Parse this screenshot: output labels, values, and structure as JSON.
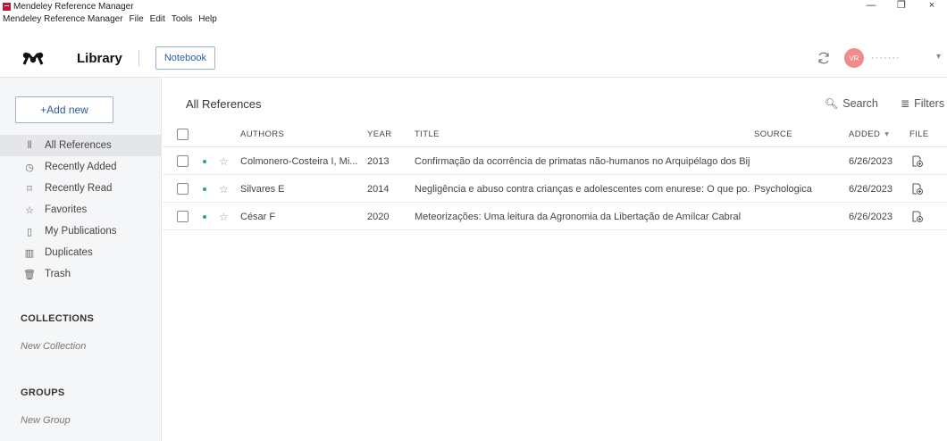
{
  "window": {
    "title": "Mendeley Reference Manager",
    "minimize": "—",
    "restore": "❐",
    "close": "×"
  },
  "menu": {
    "items": [
      "Mendeley Reference Manager",
      "File",
      "Edit",
      "Tools",
      "Help"
    ]
  },
  "header": {
    "library_label": "Library",
    "notebook_label": "Notebook",
    "avatar_initials": "VR",
    "user_name": "·······",
    "chevron": "▾"
  },
  "sidebar": {
    "add_new_label": "+Add new",
    "nav": [
      {
        "label": "All References",
        "icon": "library-icon",
        "glyph": "⫴"
      },
      {
        "label": "Recently Added",
        "icon": "clock-icon",
        "glyph": "◷"
      },
      {
        "label": "Recently Read",
        "icon": "bookmark-icon",
        "glyph": "⌑"
      },
      {
        "label": "Favorites",
        "icon": "star-icon",
        "glyph": "☆"
      },
      {
        "label": "My Publications",
        "icon": "publication-icon",
        "glyph": "▯"
      },
      {
        "label": "Duplicates",
        "icon": "duplicates-icon",
        "glyph": "▥"
      },
      {
        "label": "Trash",
        "icon": "trash-icon",
        "glyph": "🗑"
      }
    ],
    "collections_heading": "COLLECTIONS",
    "new_collection": "New Collection",
    "groups_heading": "GROUPS",
    "new_group": "New Group"
  },
  "main": {
    "title": "All References",
    "search_label": "Search",
    "filters_label": "Filters",
    "columns": {
      "authors": "AUTHORS",
      "year": "YEAR",
      "title": "TITLE",
      "source": "SOURCE",
      "added": "ADDED",
      "added_sort": "▾",
      "file": "FILE"
    },
    "rows": [
      {
        "authors": "Colmonero-Costeira I, Mi...",
        "year": "2013",
        "title": "Confirmação da ocorrência de primatas não-humanos no Arquipélago dos Bij...",
        "source": "",
        "added": "6/26/2023"
      },
      {
        "authors": "Silvares E",
        "year": "2014",
        "title": "Negligência e abuso contra crianças e adolescentes com enurese: O que po...",
        "source": "Psychologica",
        "added": "6/26/2023"
      },
      {
        "authors": "César F",
        "year": "2020",
        "title": "Meteorizações: Uma leitura da Agronomia da Libertação de Amílcar Cabral",
        "source": "",
        "added": "6/26/2023"
      }
    ]
  },
  "colors": {
    "accent": "#2a5d9f",
    "brand": "#c4122f",
    "unread_dot": "#2aa876",
    "avatar": "#f28a8a"
  }
}
